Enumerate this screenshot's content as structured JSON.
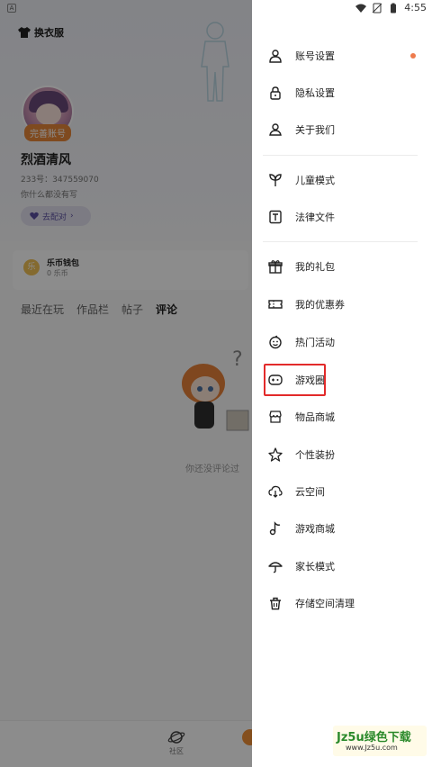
{
  "status_bar": {
    "time": "4:55"
  },
  "background": {
    "outfit_label": "换衣服",
    "complete_account_tag": "完善账号",
    "username": "烈酒清风",
    "uid": "233号：347559070",
    "bio": "你什么都没有写",
    "match_button": "去配对",
    "wallet": {
      "title": "乐币钱包",
      "value": "0 乐币",
      "coin_glyph": "乐"
    },
    "tabs": [
      "最近在玩",
      "作品栏",
      "帖子",
      "评论"
    ],
    "active_tab": "评论",
    "empty_text": "你还没评论过",
    "bottom_nav": {
      "community": "社区"
    }
  },
  "drawer": {
    "items": [
      {
        "label": "账号设置",
        "icon": "person-icon",
        "has_dot": true
      },
      {
        "label": "隐私设置",
        "icon": "lock-icon"
      },
      {
        "label": "关于我们",
        "icon": "person-outline-icon"
      },
      {
        "label": "儿童模式",
        "icon": "sprout-icon"
      },
      {
        "label": "法律文件",
        "icon": "document-t-icon"
      },
      {
        "label": "我的礼包",
        "icon": "gift-icon"
      },
      {
        "label": "我的优惠券",
        "icon": "ticket-icon"
      },
      {
        "label": "热门活动",
        "icon": "smiley-icon"
      },
      {
        "label": "游戏圈",
        "icon": "gamepad-icon",
        "highlighted": true
      },
      {
        "label": "物品商城",
        "icon": "store-icon"
      },
      {
        "label": "个性装扮",
        "icon": "star-icon"
      },
      {
        "label": "云空间",
        "icon": "cloud-download-icon"
      },
      {
        "label": "游戏商城",
        "icon": "music-note-icon"
      },
      {
        "label": "家长模式",
        "icon": "umbrella-icon"
      },
      {
        "label": "存储空间清理",
        "icon": "trash-icon"
      }
    ],
    "dot_color": "#ee7b4d",
    "highlight_color": "#e22a2a"
  },
  "watermark": {
    "top": "Jz5u绿色下载",
    "bottom": "www.Jz5u.com"
  }
}
